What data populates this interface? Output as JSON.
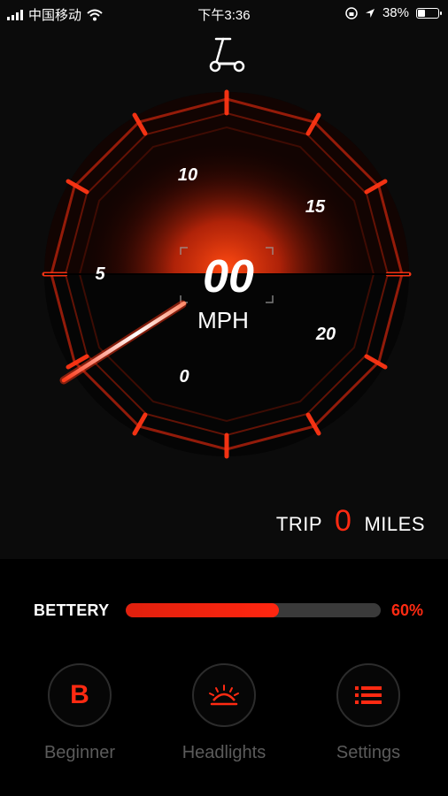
{
  "status_bar": {
    "carrier": "中国移动",
    "time": "下午3:36",
    "battery": "38%"
  },
  "speedometer": {
    "speed": "00",
    "unit": "MPH",
    "scale_labels": [
      "0",
      "5",
      "10",
      "15",
      "20"
    ],
    "icon": "scooter-icon"
  },
  "trip": {
    "label": "TRIP",
    "value": "0",
    "unit": "MILES"
  },
  "battery": {
    "label": "BETTERY",
    "percent_text": "60%",
    "level": 0.6
  },
  "modes": [
    {
      "label": "Beginner",
      "icon": "B"
    },
    {
      "label": "Headlights",
      "icon": "headlight-icon"
    },
    {
      "label": "Settings",
      "icon": "list-icon"
    }
  ],
  "colors": {
    "accent": "#ff2a12",
    "background": "#0b0b0b"
  }
}
